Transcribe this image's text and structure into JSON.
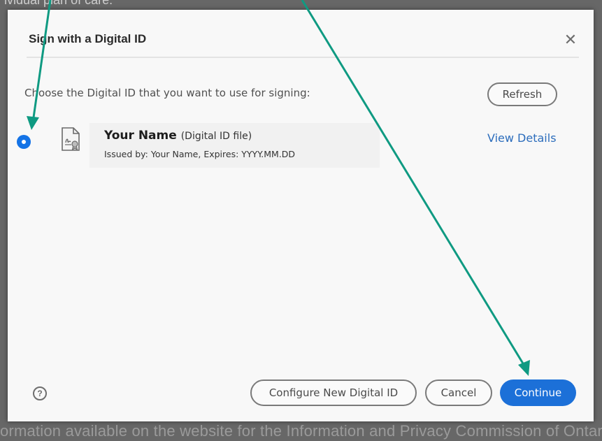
{
  "background": {
    "top_text": "ividual plan of care.",
    "bottom_text": "ormation available on the website for the Information and Privacy Commission of Ontario."
  },
  "dialog": {
    "title": "Sign with a Digital ID",
    "close_icon": "close-icon",
    "prompt": "Choose the Digital ID that you want to use for signing:",
    "refresh_label": "Refresh",
    "digital_id": {
      "name": "Your Name",
      "type": "(Digital ID file)",
      "issued": "Issued by: Your Name, Expires: YYYY.MM.DD",
      "selected": true,
      "icon": "certificate-file-icon"
    },
    "view_details_label": "View Details",
    "help_icon": "help-icon",
    "help_glyph": "?",
    "buttons": {
      "configure": "Configure New Digital ID",
      "cancel": "Cancel",
      "continue": "Continue"
    }
  },
  "colors": {
    "accent": "#1473e6",
    "annotation_arrow": "#0f9a82",
    "link": "#2c6dbc"
  }
}
